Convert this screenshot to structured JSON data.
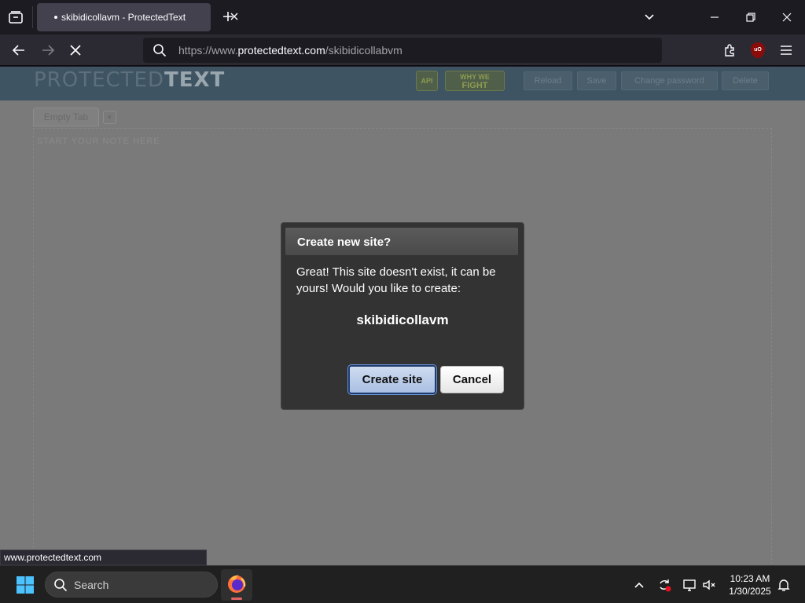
{
  "browser": {
    "tab_title": "skibidicollavm - ProtectedText",
    "url_dim_prefix": "https://www.",
    "url_domain": "protectedtext.com",
    "url_path": "/skibidicollabvm",
    "extension_label": "uO"
  },
  "page": {
    "logo_light": "PROTECTED",
    "logo_bold": "TEXT",
    "badge_api": "API",
    "badge_fight_1": "WHY WE",
    "badge_fight_2": "FIGHT",
    "header_buttons": [
      "Reload",
      "Save",
      "Change password",
      "Delete"
    ],
    "tab_label": "Empty Tab",
    "tab_dropdown": "▼",
    "hint_text": "START YOUR NOTE HERE"
  },
  "modal": {
    "title": "Create new site?",
    "message": "Great! This site doesn't exist, it can be yours! Would you like to create:",
    "site_name": "skibidicollavm",
    "create_label": "Create site",
    "cancel_label": "Cancel"
  },
  "status_bar": {
    "text": "www.protectedtext.com"
  },
  "taskbar": {
    "search_label": "Search",
    "time": "10:23 AM",
    "date": "1/30/2025"
  }
}
